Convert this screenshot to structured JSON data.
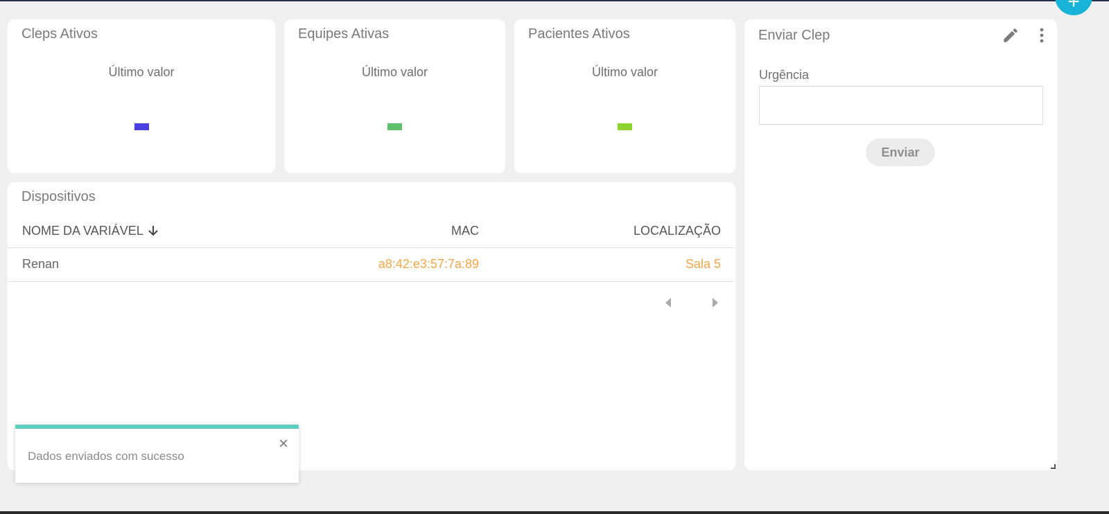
{
  "kpis": [
    {
      "title": "Cleps Ativos",
      "label": "Último valor",
      "color": "#4a3fe0"
    },
    {
      "title": "Equipes Ativas",
      "label": "Último valor",
      "color": "#5fc06b"
    },
    {
      "title": "Pacientes Ativos",
      "label": "Último valor",
      "color": "#8ed42e"
    }
  ],
  "enviar_clep": {
    "title": "Enviar Clep",
    "field_label": "Urgência",
    "field_value": "",
    "button_label": "Enviar",
    "edit_icon": "pencil-icon",
    "more_icon": "more-vertical-icon"
  },
  "devices": {
    "title": "Dispositivos",
    "columns": [
      "NOME DA VARIÁVEL",
      "MAC",
      "LOCALIZAÇÃO"
    ],
    "sort_icon": "arrow-down-icon",
    "rows": [
      {
        "name": "Renan",
        "mac": "a8:42:e3:57:7a:89",
        "location": "Sala 5"
      }
    ],
    "value_color": "#f2a74a"
  },
  "toast": {
    "message": "Dados enviados com sucesso",
    "close_label": "×",
    "accent": "#5ecfbf"
  },
  "fab": {
    "label": "+",
    "color": "#19b3d8"
  }
}
